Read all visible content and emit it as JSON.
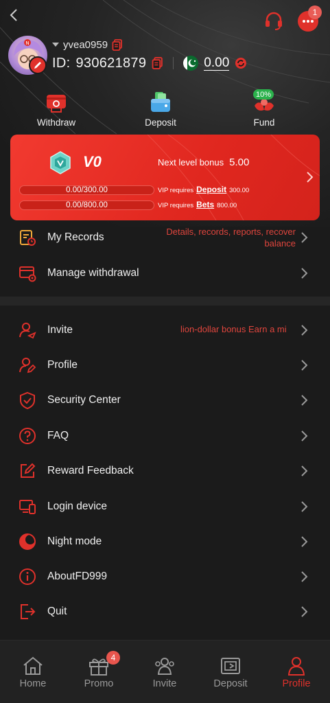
{
  "header": {
    "username": "yvea0959",
    "id_label": "ID:",
    "id_value": "930621879",
    "balance": "0.00",
    "message_badge": "1"
  },
  "actions": [
    {
      "label": "Withdraw",
      "icon": "withdraw-icon"
    },
    {
      "label": "Deposit",
      "icon": "deposit-wallet-icon"
    },
    {
      "label": "Fund",
      "icon": "fund-icon",
      "badge": "10%"
    }
  ],
  "vip": {
    "level": "V0",
    "next_bonus_label": "Next level bonus",
    "next_bonus_value": "5.00",
    "deposit_progress": "0.00/300.00",
    "bets_progress": "0.00/800.00",
    "req_prefix": "VIP requires",
    "deposit_label": "Deposit",
    "deposit_required": "300.00",
    "bets_label": "Bets",
    "bets_required": "800.00"
  },
  "menu_top": [
    {
      "label": "My Records",
      "hint": "Details, records, reports, recover balance"
    },
    {
      "label": "Manage withdrawal"
    }
  ],
  "menu": [
    {
      "label": "Invite",
      "hint": "lion-dollar bonus  Earn a mi"
    },
    {
      "label": "Profile"
    },
    {
      "label": "Security Center"
    },
    {
      "label": "FAQ"
    },
    {
      "label": "Reward Feedback"
    },
    {
      "label": "Login device"
    },
    {
      "label": "Night mode"
    },
    {
      "label": "AboutFD999"
    },
    {
      "label": "Quit"
    }
  ],
  "nav": [
    {
      "label": "Home"
    },
    {
      "label": "Promo",
      "badge": "4"
    },
    {
      "label": "Invite"
    },
    {
      "label": "Deposit"
    },
    {
      "label": "Profile",
      "active": true
    }
  ],
  "colors": {
    "accent": "#e0312b",
    "background": "#1b1b1b",
    "vip_card": "#e62c23"
  }
}
